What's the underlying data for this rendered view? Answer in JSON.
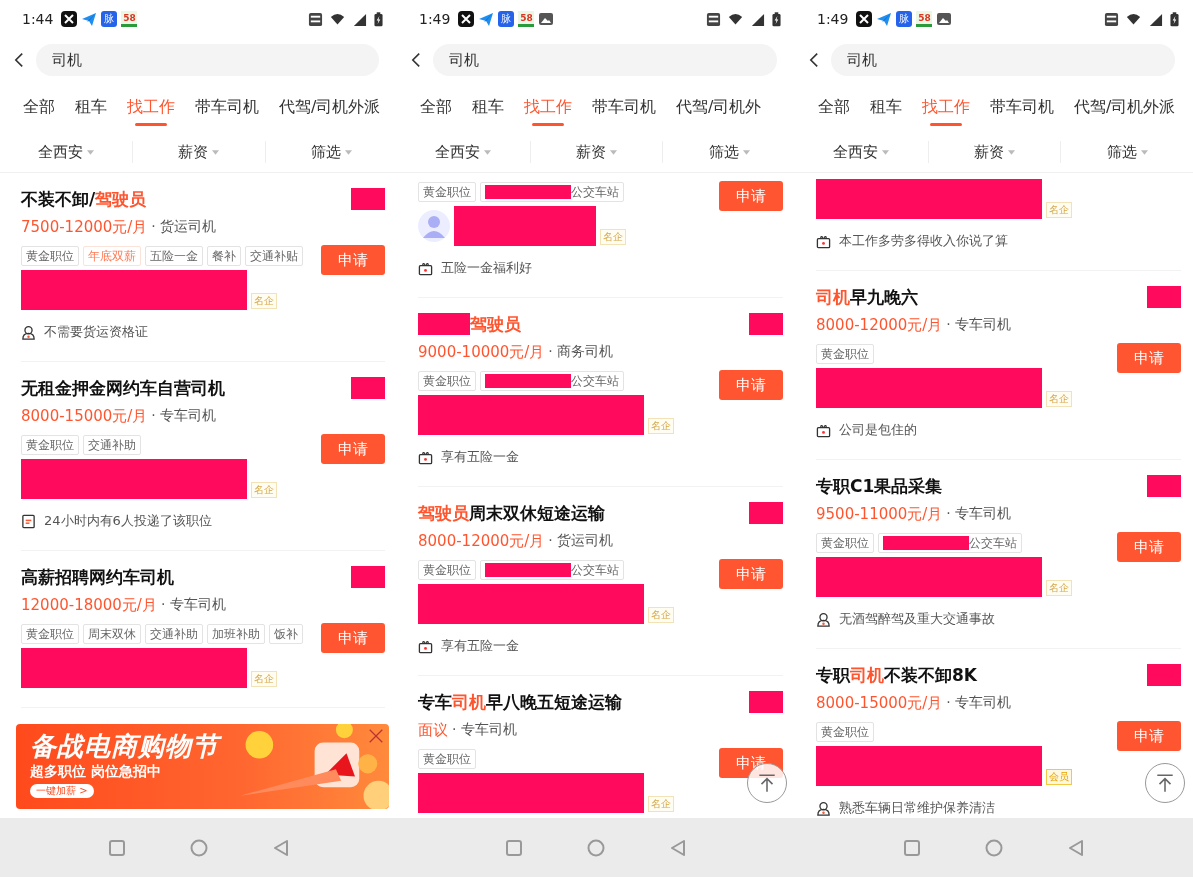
{
  "phones": [
    {
      "status_bar": {
        "time": "1:44",
        "app_icons": [
          {
            "kind": "cut"
          },
          {
            "kind": "plane"
          },
          {
            "kind": "label",
            "text": "脉"
          },
          {
            "kind": "badge58",
            "text": "58"
          }
        ]
      },
      "search": {
        "value": "司机"
      },
      "tabs": [
        {
          "label": "全部",
          "selected": false
        },
        {
          "label": "租车",
          "selected": false
        },
        {
          "label": "找工作",
          "selected": true
        },
        {
          "label": "带车司机",
          "selected": false
        },
        {
          "label": "代驾/司机外派",
          "selected": false
        }
      ],
      "filters": [
        "全西安",
        "薪资",
        "筛选"
      ],
      "cards": [
        {
          "partial": false,
          "title": [
            {
              "kind": "text",
              "text": "不装不卸/"
            },
            {
              "kind": "highlight",
              "text": "驾驶员"
            }
          ],
          "salary": "7500-12000元/月",
          "category": "· 货运司机",
          "tags": [
            {
              "kind": "plain",
              "text": "黄金职位"
            },
            {
              "kind": "highlight",
              "text": "年底双薪"
            },
            {
              "kind": "plain",
              "text": "五险一金"
            },
            {
              "kind": "plain",
              "text": "餐补"
            },
            {
              "kind": "plain",
              "text": "交通补贴"
            }
          ],
          "badge": {
            "kind": "famous",
            "text": "名企"
          },
          "perk": {
            "kind": "person",
            "text": "不需要货运资格证"
          },
          "apply": "申请"
        },
        {
          "partial": false,
          "title": [
            {
              "kind": "text",
              "text": "无租金押金网约车自营司机"
            }
          ],
          "salary": "8000-15000元/月",
          "category": "· 专车司机",
          "tags": [
            {
              "kind": "plain",
              "text": "黄金职位"
            },
            {
              "kind": "plain",
              "text": "交通补助"
            }
          ],
          "badge": {
            "kind": "famous",
            "text": "名企"
          },
          "perk": {
            "kind": "document",
            "text": "24小时内有6人投递了该职位"
          },
          "apply": "申请"
        },
        {
          "partial": false,
          "title": [
            {
              "kind": "text",
              "text": "高薪招聘网约车司机"
            }
          ],
          "salary": "12000-18000元/月",
          "category": "· 专车司机",
          "tags": [
            {
              "kind": "plain",
              "text": "黄金职位"
            },
            {
              "kind": "plain",
              "text": "周末双休"
            },
            {
              "kind": "plain",
              "text": "交通补助"
            },
            {
              "kind": "plain",
              "text": "加班补助"
            },
            {
              "kind": "plain",
              "text": "饭补"
            }
          ],
          "badge": {
            "kind": "famous",
            "text": "名企"
          },
          "apply": "申请"
        }
      ],
      "ad": {
        "title": "备战电商购物节",
        "subtitle": "超多职位 岗位急招中",
        "button": "一键加薪 >"
      },
      "back_to_top": false
    },
    {
      "status_bar": {
        "time": "1:49",
        "app_icons": [
          {
            "kind": "cut"
          },
          {
            "kind": "plane"
          },
          {
            "kind": "label",
            "text": "脉"
          },
          {
            "kind": "badge58",
            "text": "58"
          },
          {
            "kind": "gallery"
          }
        ]
      },
      "search": {
        "value": "司机"
      },
      "tabs": [
        {
          "label": "全部",
          "selected": false
        },
        {
          "label": "租车",
          "selected": false
        },
        {
          "label": "找工作",
          "selected": true
        },
        {
          "label": "带车司机",
          "selected": false
        },
        {
          "label": "代驾/司机外",
          "selected": false
        }
      ],
      "filters": [
        "全西安",
        "薪资",
        "筛选"
      ],
      "cards": [
        {
          "partial": true,
          "tags": [
            {
              "kind": "plain",
              "text": "黄金职位"
            },
            {
              "kind": "location",
              "text": "公交车站"
            }
          ],
          "avatar": true,
          "badge": {
            "kind": "famous",
            "text": "名企"
          },
          "perk": {
            "kind": "gift",
            "text": "五险一金福利好"
          },
          "apply": "申请"
        },
        {
          "partial": false,
          "title_prefix_redacted": true,
          "title": [
            {
              "kind": "highlight",
              "text": "驾驶员"
            }
          ],
          "salary": "9000-10000元/月",
          "category": "· 商务司机",
          "tags": [
            {
              "kind": "plain",
              "text": "黄金职位"
            },
            {
              "kind": "location",
              "text": "公交车站"
            }
          ],
          "badge": {
            "kind": "famous",
            "text": "名企"
          },
          "perk": {
            "kind": "gift",
            "text": "享有五险一金"
          },
          "apply": "申请"
        },
        {
          "partial": false,
          "title": [
            {
              "kind": "highlight",
              "text": "驾驶员"
            },
            {
              "kind": "text",
              "text": "周末双休短途运输"
            }
          ],
          "salary": "8000-12000元/月",
          "category": "· 货运司机",
          "tags": [
            {
              "kind": "plain",
              "text": "黄金职位"
            },
            {
              "kind": "location",
              "text": "公交车站"
            }
          ],
          "badge": {
            "kind": "famous",
            "text": "名企"
          },
          "perk": {
            "kind": "gift",
            "text": "享有五险一金"
          },
          "apply": "申请"
        },
        {
          "partial": false,
          "title": [
            {
              "kind": "text",
              "text": "专车"
            },
            {
              "kind": "highlight",
              "text": "司机"
            },
            {
              "kind": "text",
              "text": "早八晚五短途运输"
            }
          ],
          "salary": "面议",
          "category": "· 专车司机",
          "tags": [
            {
              "kind": "plain",
              "text": "黄金职位"
            }
          ],
          "badge": {
            "kind": "famous",
            "text": "名企"
          },
          "apply": "申请"
        }
      ],
      "back_to_top": true
    },
    {
      "status_bar": {
        "time": "1:49",
        "app_icons": [
          {
            "kind": "cut"
          },
          {
            "kind": "plane"
          },
          {
            "kind": "label",
            "text": "脉"
          },
          {
            "kind": "badge58",
            "text": "58"
          },
          {
            "kind": "gallery"
          }
        ]
      },
      "search": {
        "value": "司机"
      },
      "tabs": [
        {
          "label": "全部",
          "selected": false
        },
        {
          "label": "租车",
          "selected": false
        },
        {
          "label": "找工作",
          "selected": true
        },
        {
          "label": "带车司机",
          "selected": false
        },
        {
          "label": "代驾/司机外派",
          "selected": false
        }
      ],
      "filters": [
        "全西安",
        "薪资",
        "筛选"
      ],
      "cards": [
        {
          "partial": true,
          "badge": {
            "kind": "famous",
            "text": "名企"
          },
          "perk": {
            "kind": "gift",
            "text": "本工作多劳多得收入你说了算"
          }
        },
        {
          "partial": false,
          "title": [
            {
              "kind": "highlight",
              "text": "司机"
            },
            {
              "kind": "text",
              "text": "早九晚六"
            }
          ],
          "salary": "8000-12000元/月",
          "category": "· 专车司机",
          "tags": [
            {
              "kind": "plain",
              "text": "黄金职位"
            }
          ],
          "badge": {
            "kind": "famous",
            "text": "名企"
          },
          "perk": {
            "kind": "gift",
            "text": "公司是包住的"
          },
          "apply": "申请"
        },
        {
          "partial": false,
          "title": [
            {
              "kind": "text",
              "text": "专职C1果品采集"
            }
          ],
          "salary": "9500-11000元/月",
          "category": "· 专车司机",
          "tags": [
            {
              "kind": "plain",
              "text": "黄金职位"
            },
            {
              "kind": "location",
              "text": "公交车站"
            }
          ],
          "badge": {
            "kind": "famous",
            "text": "名企"
          },
          "perk": {
            "kind": "person",
            "text": "无酒驾醉驾及重大交通事故"
          },
          "apply": "申请"
        },
        {
          "partial": false,
          "title": [
            {
              "kind": "text",
              "text": "专职"
            },
            {
              "kind": "highlight",
              "text": "司机"
            },
            {
              "kind": "text",
              "text": "不装不卸8K"
            }
          ],
          "salary": "8000-15000元/月",
          "category": "· 专车司机",
          "tags": [
            {
              "kind": "plain",
              "text": "黄金职位"
            }
          ],
          "badge": {
            "kind": "member",
            "text": "会员"
          },
          "perk": {
            "kind": "person",
            "text": "熟悉车辆日常维护保养清洁"
          },
          "apply": "申请"
        }
      ],
      "back_to_top": true
    }
  ]
}
